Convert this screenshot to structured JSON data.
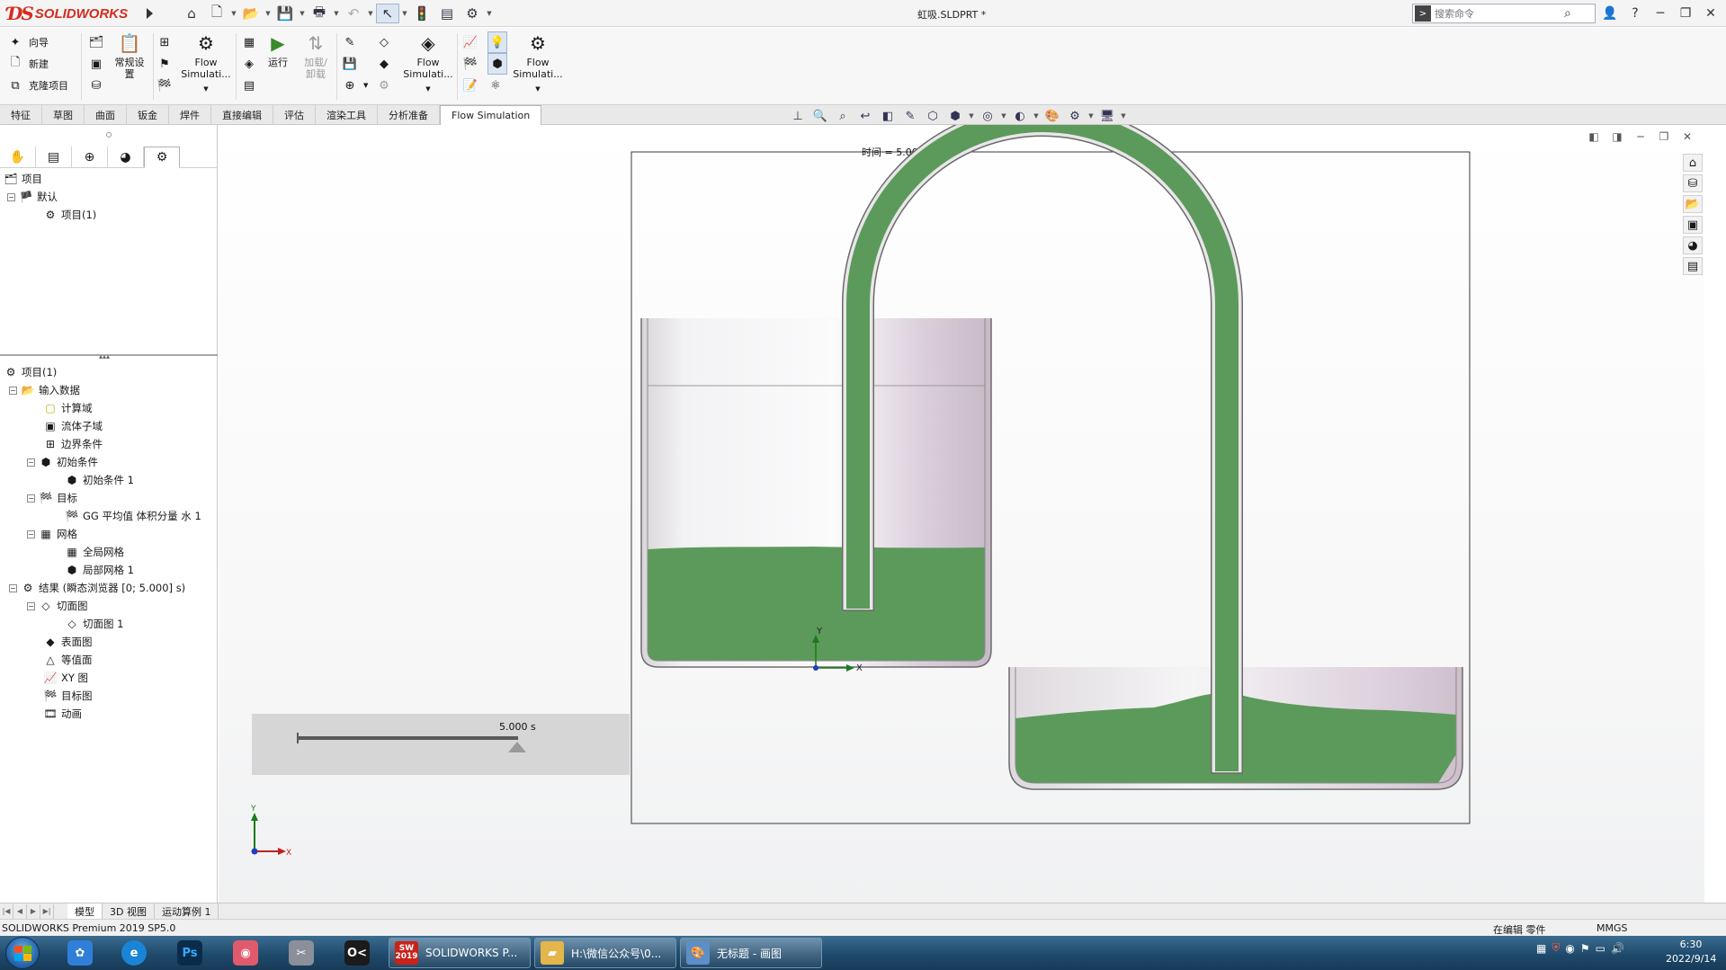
{
  "titlebar": {
    "doc_title": "虹吸.SLDPRT *",
    "search_placeholder": "搜索命令",
    "logo_ds": "ƊS",
    "logo_text": "SOLIDWORKS"
  },
  "ribbon": {
    "wizard": "向导",
    "new": "新建",
    "clone": "克隆项目",
    "general_settings": "常规设置",
    "flow_sim_1": "Flow Simulati...",
    "run": "运行",
    "load_unload": "加载/卸载",
    "flow_sim_2": "Flow Simulati...",
    "flow_sim_3": "Flow Simulati..."
  },
  "tabs": [
    "特征",
    "草图",
    "曲面",
    "钣金",
    "焊件",
    "直接编辑",
    "评估",
    "渲染工具",
    "分析准备",
    "Flow Simulation"
  ],
  "active_tab": "Flow Simulation",
  "top_tree": {
    "project": "项目",
    "default": "默认",
    "project_1": "项目(1)"
  },
  "tree": {
    "root": "项目(1)",
    "input_data": "输入数据",
    "comp_domain": "计算域",
    "fluid_subdomain": "流体子域",
    "boundary_conditions": "边界条件",
    "initial_conditions": "初始条件",
    "initial_condition_1": "初始条件 1",
    "goals": "目标",
    "goal_1": "GG 平均值 体积分量 水 1",
    "mesh": "网格",
    "global_mesh": "全局网格",
    "local_mesh_1": "局部网格 1",
    "results": "结果 (瞬态浏览器 [0; 5.000] s)",
    "cut_plots": "切面图",
    "cut_plot_1": "切面图 1",
    "surface_plots": "表面图",
    "isosurfaces": "等值面",
    "xy_plots": "XY 图",
    "goal_plots": "目标图",
    "animations": "动画"
  },
  "graphics": {
    "sim_time_label": "时间 = 5.000 s",
    "anim_time": "5.000 s",
    "axis_x": "X",
    "axis_y": "Y"
  },
  "bottom_tabs": [
    "模型",
    "3D 视图",
    "运动算例 1"
  ],
  "status": {
    "product": "SOLIDWORKS Premium 2019 SP5.0",
    "editing": "在编辑 零件",
    "units": "MMGS"
  },
  "taskbar": {
    "sw_label": "2019",
    "task_sw": "SOLIDWORKS P...",
    "task_folder": "H:\\微信公众号\\0...",
    "task_paint": "无标题 - 画图",
    "time": "6:30",
    "date": "2022/9/14"
  },
  "colors": {
    "fluid_green": "#5b9a5b",
    "brand_red": "#d52b1e"
  }
}
